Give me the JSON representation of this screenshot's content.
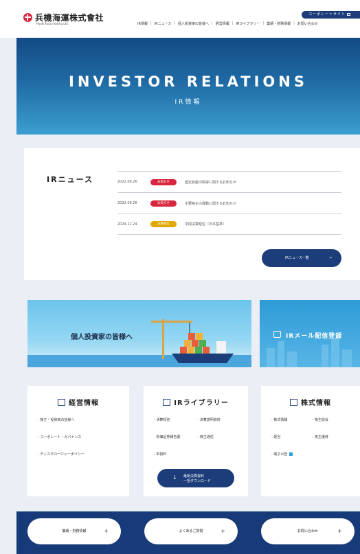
{
  "header": {
    "logo_text": "兵機海運株式會社",
    "logo_sub": "Hyoki Kaiun Kaisha,Ltd.",
    "corporate_button": "コーポレートサイト",
    "nav": [
      "IR情報",
      "IRニュース",
      "個人投資家の皆様へ",
      "経営情報",
      "IRライブラリー",
      "業績・財務情報",
      "お問い合わせ"
    ]
  },
  "hero": {
    "title": "INVESTOR RELATIONS",
    "subtitle": "IR情報"
  },
  "news": {
    "title": "IRニュース",
    "items": [
      {
        "date": "2022.08.26",
        "tag": "お知らせ",
        "text": "固定資産の取得に関するお知らせ"
      },
      {
        "date": "2022.08.26",
        "tag": "お知らせ",
        "text": "主要株主の異動に関するお知らせ"
      },
      {
        "date": "2024.12.24",
        "tag": "決算短信",
        "text": "中間決算短信（日本基準）"
      }
    ],
    "more_label": "IRニュース一覧",
    "more_arrow": "→"
  },
  "banners": {
    "individual": "個人投資家の皆様へ",
    "mail": "IRメール配信登録"
  },
  "cards": {
    "management": {
      "title": "経営情報",
      "links": [
        "株主・投資家の皆様へ",
        "コーポレート・ガバナンス",
        "ディスクロージャーポリシー"
      ]
    },
    "library": {
      "title": "IRライブラリー",
      "links": [
        "決算短信",
        "決算説明資料",
        "有価証券報告書",
        "株主通信",
        "IR資料"
      ],
      "download_line1": "最新決算資料",
      "download_line2": "一括ダウンロード",
      "download_icon": "↓"
    },
    "stock": {
      "title": "株式情報",
      "links": [
        "株式情報",
        "株主総会",
        "配当",
        "株主優待",
        "電子公告"
      ]
    }
  },
  "bottom": {
    "buttons": [
      "業績・財務情報",
      "よくあるご質問",
      "お問い合わせ"
    ],
    "plus": "+"
  },
  "colors": {
    "primary": "#1d3d7a",
    "tag_red": "#d7263d",
    "tag_yellow": "#e0a800",
    "hero_top": "#144a84",
    "hero_bottom": "#3c9fcf"
  }
}
